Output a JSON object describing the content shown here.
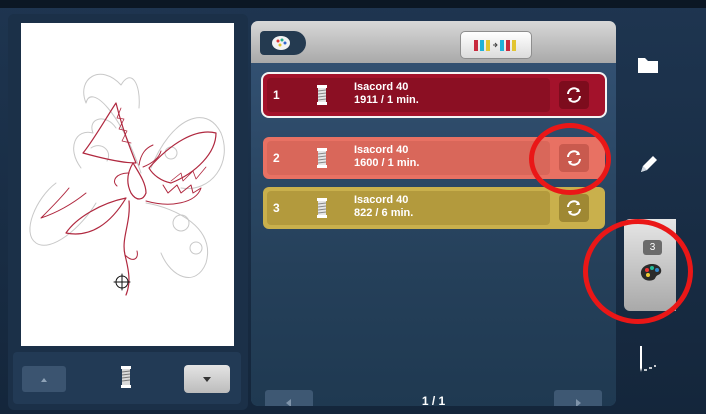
{
  "threads": [
    {
      "index": "1",
      "brand": "Isacord 40",
      "detail": "1911 / 1 min.",
      "color": "#a3122b"
    },
    {
      "index": "2",
      "brand": "Isacord 40",
      "detail": "1600 / 1 min.",
      "color": "#e87163"
    },
    {
      "index": "3",
      "brand": "Isacord 40",
      "detail": "822 / 6 min.",
      "color": "#c9b04c"
    }
  ],
  "pager": {
    "label": "1 / 1"
  },
  "nav": {
    "color_count": "3"
  },
  "icons": {
    "tab": "palette-icon",
    "header": "thread-sort-icon",
    "swap": "swap-icon",
    "spool": "spool-icon",
    "nav": [
      "folder-icon",
      "pencil-icon",
      "palette-icon",
      "needle-icon"
    ],
    "left_buttons": [
      "arrow-up-icon",
      "spool-icon",
      "arrow-down-icon"
    ]
  },
  "colors": {
    "annotation": "#ea1717",
    "accent": "#2a4661"
  }
}
